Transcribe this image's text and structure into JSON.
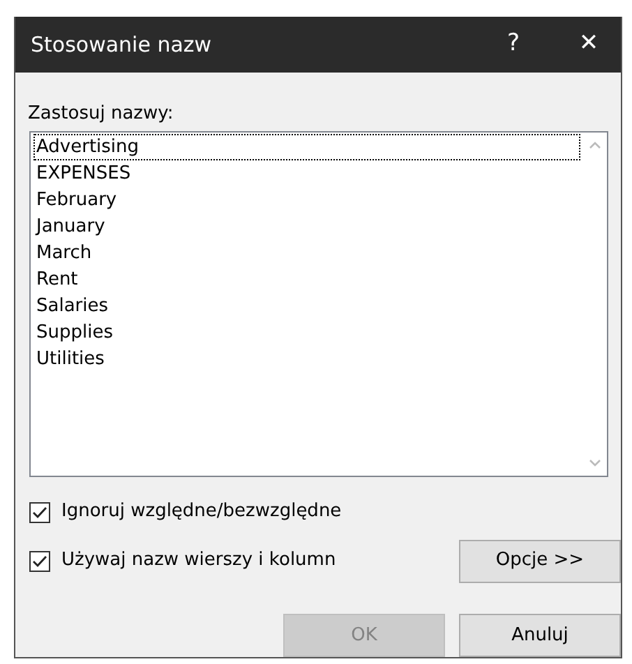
{
  "window": {
    "title": "Stosowanie nazw",
    "help": "?",
    "close": "✕"
  },
  "list_label": "Zastosuj nazwy:",
  "names": [
    {
      "label": "Advertising",
      "focused": true
    },
    {
      "label": "EXPENSES",
      "focused": false
    },
    {
      "label": "February",
      "focused": false
    },
    {
      "label": "January",
      "focused": false
    },
    {
      "label": "March",
      "focused": false
    },
    {
      "label": "Rent",
      "focused": false
    },
    {
      "label": "Salaries",
      "focused": false
    },
    {
      "label": "Supplies",
      "focused": false
    },
    {
      "label": "Utilities",
      "focused": false
    }
  ],
  "checkboxes": [
    {
      "label": "Ignoruj względne/bezwzględne",
      "checked": true
    },
    {
      "label": "Używaj nazw wierszy i kolumn",
      "checked": true
    }
  ],
  "options_button": "Opcje >>",
  "buttons": [
    {
      "label": "OK",
      "disabled": true
    },
    {
      "label": "Anuluj",
      "disabled": false
    }
  ]
}
